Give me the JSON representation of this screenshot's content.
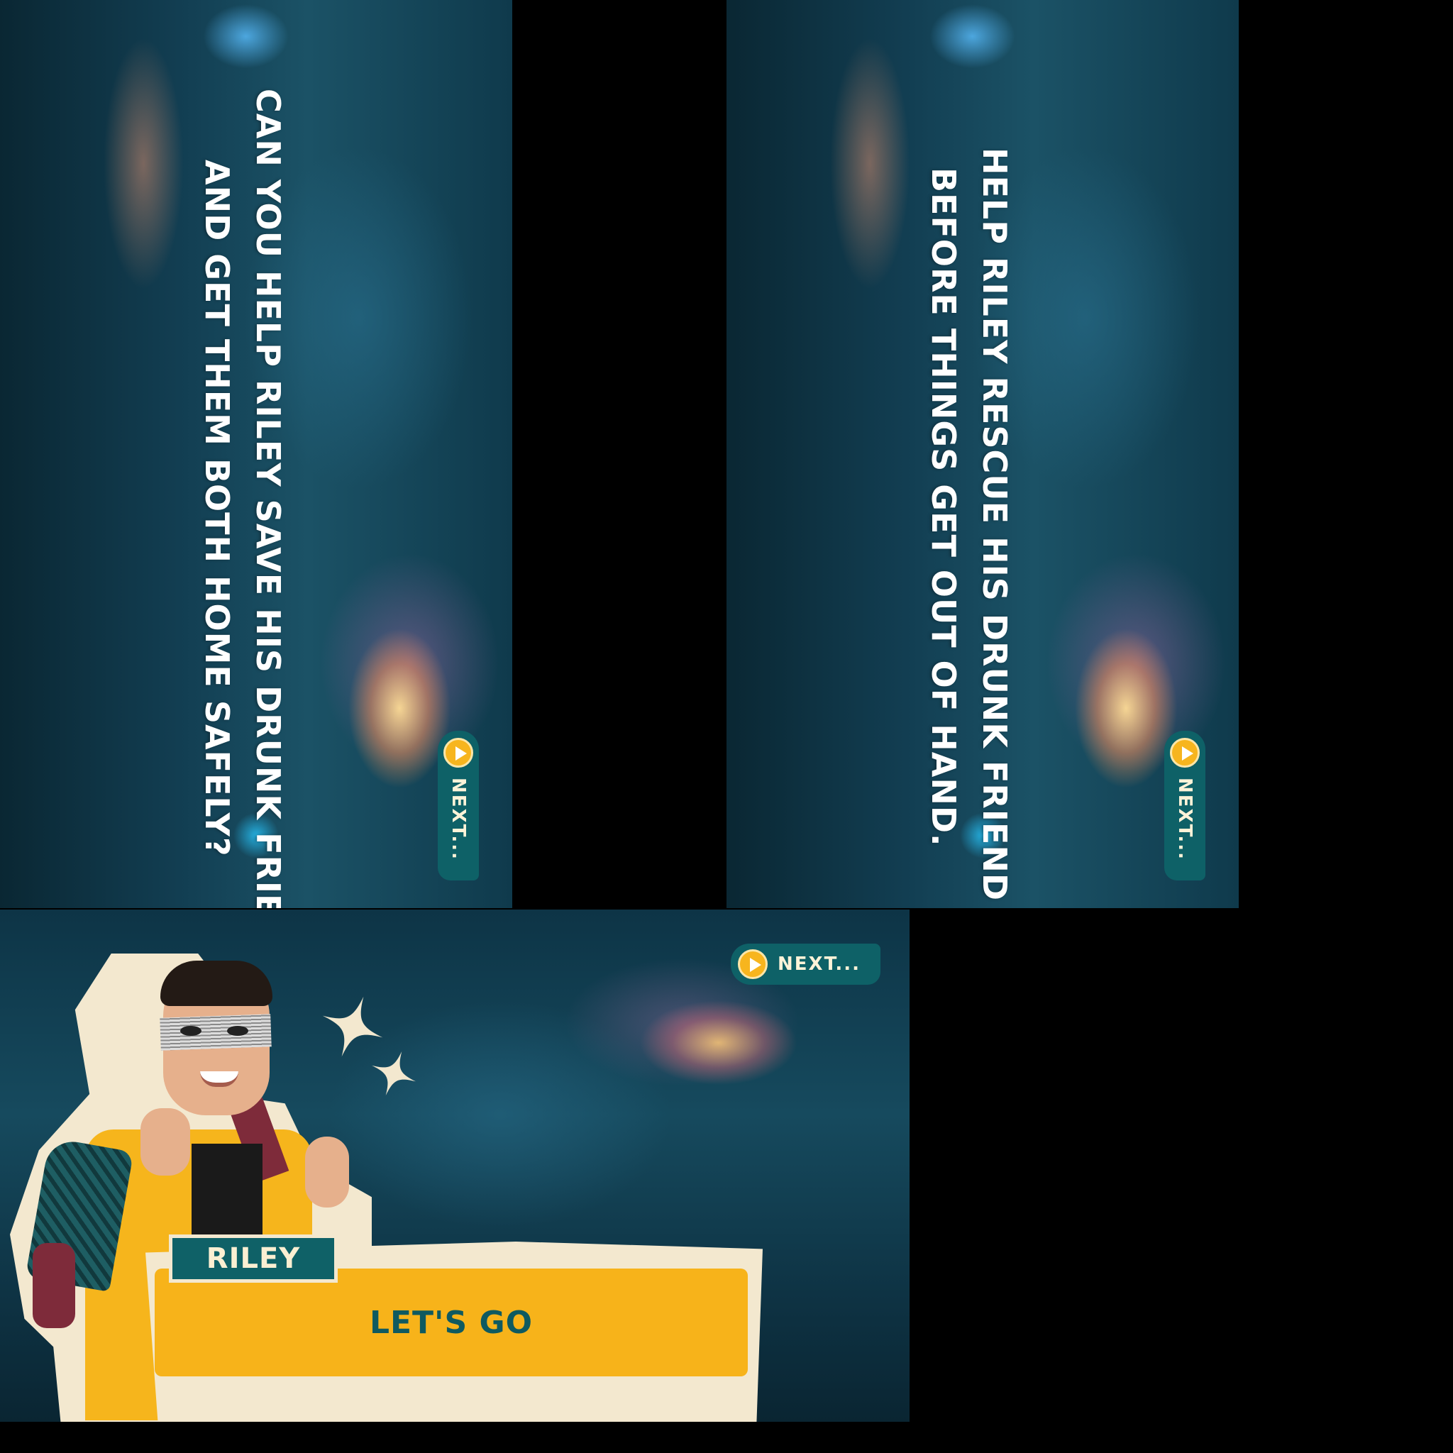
{
  "scenes": [
    {
      "lines": [
        "CAN YOU HELP RILEY SAVE HIS DRUNK FRIEND",
        "AND GET THEM BOTH HOME SAFELY?"
      ],
      "next_label": "NEXT..."
    },
    {
      "lines": [
        "HELP RILEY RESCUE HIS DRUNK FRIEND",
        "BEFORE THINGS GET OUT OF HAND."
      ],
      "next_label": "NEXT..."
    }
  ],
  "dialog": {
    "speaker": "RILEY",
    "text": "LET'S GO",
    "next_label": "NEXT..."
  },
  "colors": {
    "accent_yellow": "#f7b31a",
    "accent_teal": "#0f6167",
    "paper": "#f3e8cf"
  },
  "icons": {
    "next": "play-circle-icon",
    "decoration": "sparkle-icon"
  }
}
